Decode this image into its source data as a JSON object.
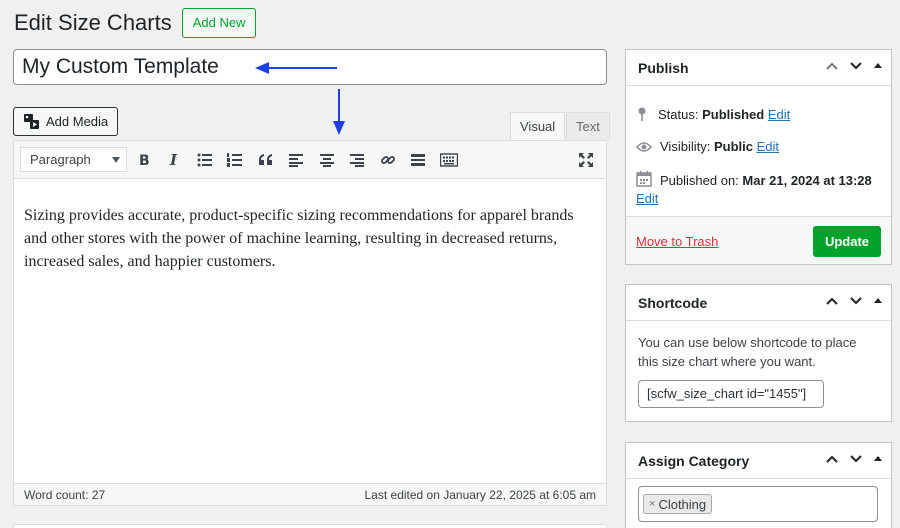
{
  "header": {
    "title": "Edit Size Charts",
    "add_new_label": "Add New"
  },
  "post": {
    "title": "My Custom Template"
  },
  "editor": {
    "add_media_label": "Add Media",
    "tabs": {
      "visual": "Visual",
      "text": "Text"
    },
    "format": "Paragraph",
    "content": "Sizing provides accurate, product-specific sizing recommendations for apparel brands and other stores with the power of machine learning, resulting in decreased returns, increased sales, and happier customers.",
    "word_count": "Word count: 27",
    "last_edited": "Last edited on January 22, 2025 at 6:05 am"
  },
  "publish": {
    "title": "Publish",
    "status_label": "Status:",
    "status_value": "Published",
    "visibility_label": "Visibility:",
    "visibility_value": "Public",
    "published_label": "Published on:",
    "published_value": "Mar 21, 2024 at 13:28",
    "edit": "Edit",
    "trash_label": "Move to Trash",
    "update_label": "Update"
  },
  "shortcode": {
    "title": "Shortcode",
    "description": "You can use below shortcode to place this size chart where you want.",
    "value": "[scfw_size_chart id=\"1455\"]"
  },
  "category": {
    "title": "Assign Category",
    "chip_remove": "×",
    "selected": "Clothing"
  },
  "colors": {
    "accent_green": "#00a32a",
    "link_blue": "#2271b1",
    "trash_red": "#d63638",
    "annotation_arrow": "#1f3fe6"
  }
}
